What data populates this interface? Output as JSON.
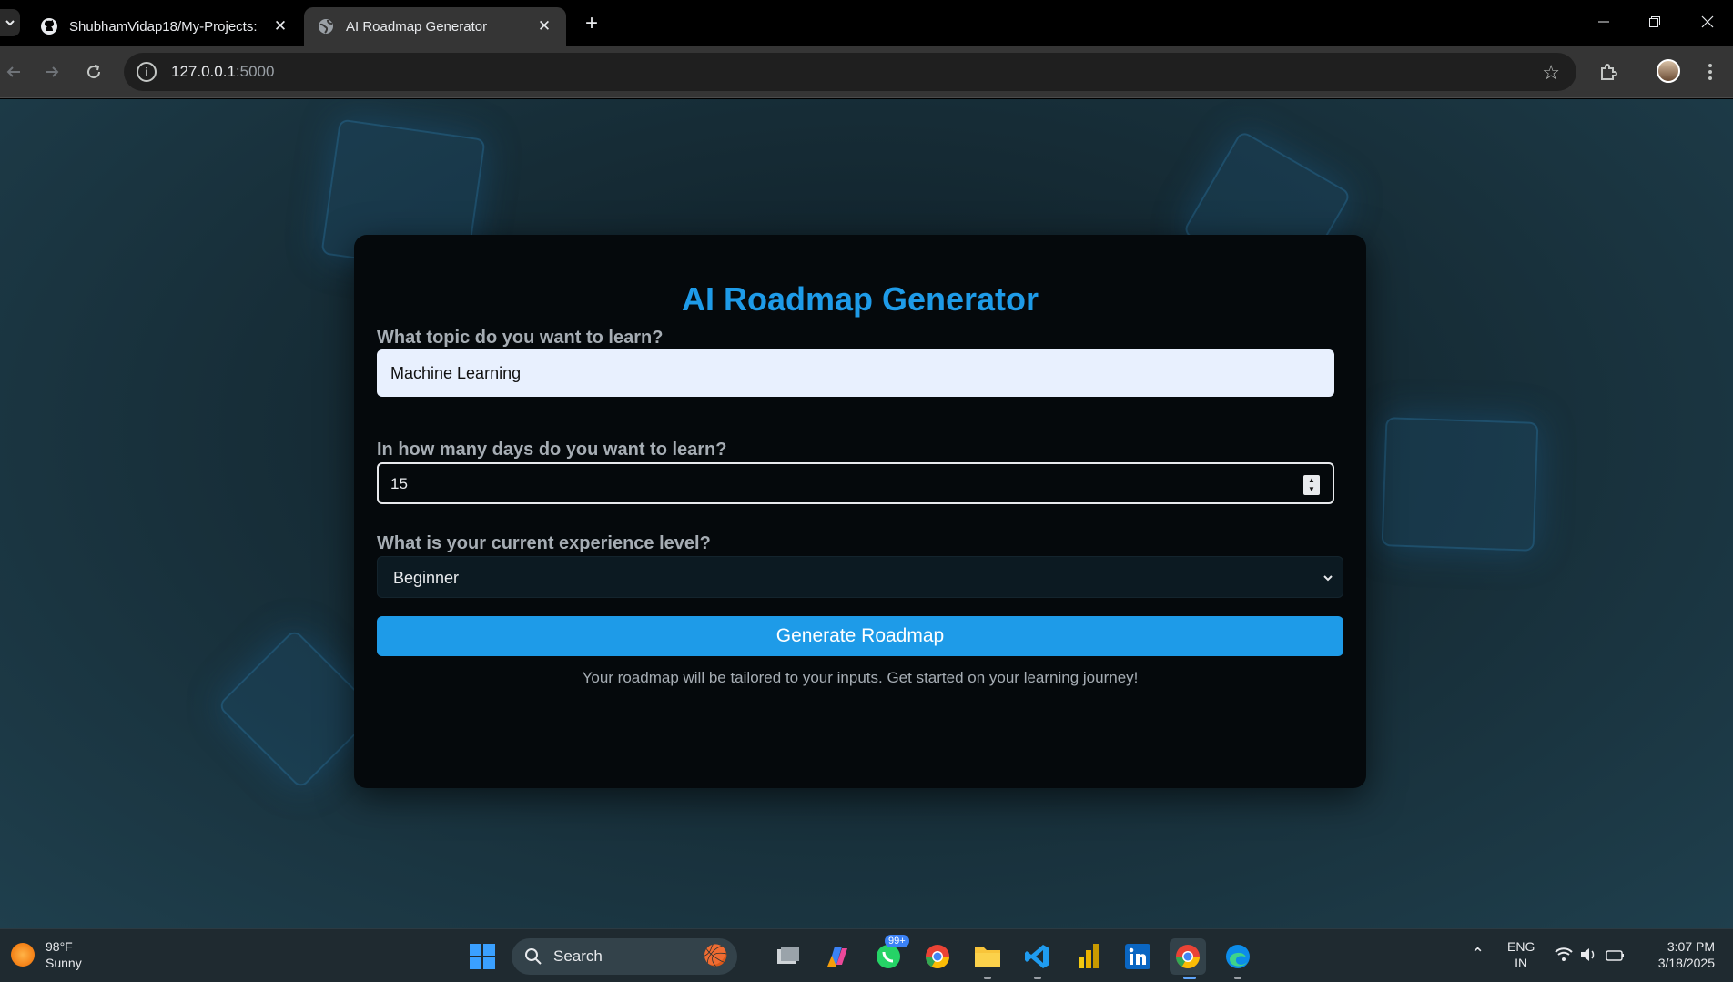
{
  "browser": {
    "tabs": [
      {
        "title": "ShubhamVidap18/My-Projects:"
      },
      {
        "title": "AI Roadmap Generator"
      }
    ],
    "new_tab": "+",
    "url_host": "127.0.0.1",
    "url_port": ":5000"
  },
  "app": {
    "title": "AI Roadmap Generator",
    "topic_label": "What topic do you want to learn?",
    "topic_value": "Machine Learning",
    "days_label": "In how many days do you want to learn?",
    "days_value": "15",
    "level_label": "What is your current experience level?",
    "level_value": "Beginner",
    "button_label": "Generate Roadmap",
    "note": "Your roadmap will be tailored to your inputs. Get started on your learning journey!",
    "accent_color": "#1e9be8"
  },
  "taskbar": {
    "weather_temp": "98°F",
    "weather_desc": "Sunny",
    "search_label": "Search",
    "whatsapp_badge": "99+",
    "lang_1": "ENG",
    "lang_2": "IN",
    "time": "3:07 PM",
    "date": "3/18/2025"
  }
}
